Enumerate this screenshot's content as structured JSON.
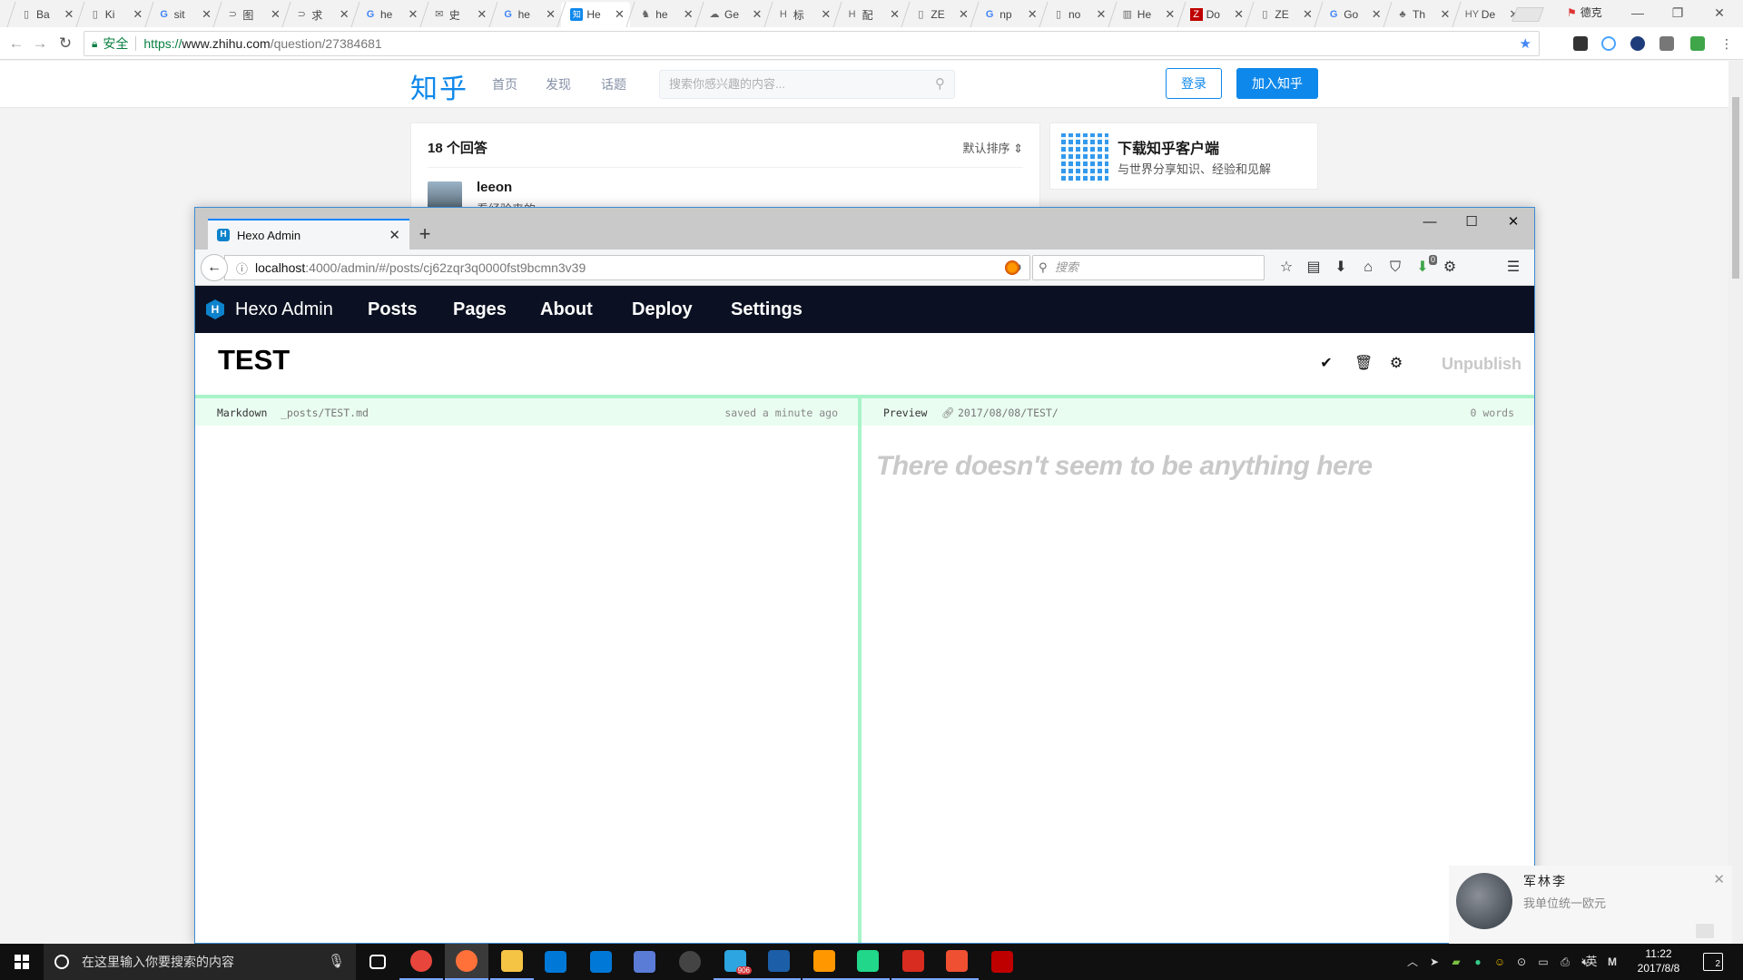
{
  "chrome": {
    "tabs": [
      {
        "icon": "page-icon",
        "title": "Ba"
      },
      {
        "icon": "page-icon",
        "title": "Ki"
      },
      {
        "icon": "google-icon",
        "title": "sit"
      },
      {
        "icon": "arrow-icon",
        "title": "图"
      },
      {
        "icon": "arrow-icon",
        "title": "求"
      },
      {
        "icon": "google-icon",
        "title": "he"
      },
      {
        "icon": "mail-icon",
        "title": "史"
      },
      {
        "icon": "google-icon",
        "title": "he"
      },
      {
        "icon": "zhihu-icon",
        "title": "He",
        "active": true
      },
      {
        "icon": "github-icon",
        "title": "he"
      },
      {
        "icon": "cloud-icon",
        "title": "Ge"
      },
      {
        "icon": "hexo-icon",
        "title": "标"
      },
      {
        "icon": "hexo-icon",
        "title": "配"
      },
      {
        "icon": "page-icon",
        "title": "ZE"
      },
      {
        "icon": "google-icon",
        "title": "np"
      },
      {
        "icon": "page-icon",
        "title": "no"
      },
      {
        "icon": "book-icon",
        "title": "He"
      },
      {
        "icon": "filezilla-icon",
        "title": "Do"
      },
      {
        "icon": "page-icon",
        "title": "ZE"
      },
      {
        "icon": "google-icon",
        "title": "Go"
      },
      {
        "icon": "baidu-icon",
        "title": "Th"
      },
      {
        "icon": "hy-icon",
        "title": "De"
      }
    ],
    "user_label": "德克",
    "window_controls": {
      "minimize": "—",
      "restore": "❐",
      "close": "✕"
    },
    "omnibox": {
      "secure_label": "安全",
      "protocol": "https://",
      "host": "www.zhihu.com",
      "path": "/question/27384681"
    }
  },
  "zhihu": {
    "logo": "知乎",
    "nav": [
      "首页",
      "发现",
      "话题"
    ],
    "search_placeholder": "搜索你感兴趣的内容...",
    "login_label": "登录",
    "join_label": "加入知乎",
    "answer_count": "18 个回答",
    "sort_label": "默认排序",
    "answer_user": "leeon",
    "answer_bio": "看经验来的",
    "app_title": "下载知乎客户端",
    "app_subtitle": "与世界分享知识、经验和见解"
  },
  "firefox": {
    "tab_title": "Hexo Admin",
    "url_host": "localhost",
    "url_path": ":4000/admin/#/posts/cj62zqr3q0000fst9bcmn3v39",
    "search_placeholder": "搜索",
    "download_badge": "0"
  },
  "hexo": {
    "brand": "Hexo Admin",
    "brand_logo": "H",
    "nav": [
      "Posts",
      "Pages",
      "About",
      "Deploy",
      "Settings"
    ],
    "post_title": "TEST",
    "unpublish_label": "Unpublish",
    "editor": {
      "label": "Markdown",
      "path": "_posts/TEST.md",
      "status": "saved a minute ago"
    },
    "preview": {
      "label": "Preview",
      "permalink": "2017/08/08/TEST/",
      "word_count": "0 words",
      "empty_text": "There doesn't seem to be anything here"
    }
  },
  "notification": {
    "name": "军林李",
    "message": "我单位统一欧元"
  },
  "taskbar": {
    "search_placeholder": "在这里输入你要搜索的内容",
    "apps": [
      {
        "name": "task-view",
        "color": "#101010"
      },
      {
        "name": "chrome",
        "color": "#e8453c"
      },
      {
        "name": "firefox",
        "color": "#ff7139"
      },
      {
        "name": "file-explorer",
        "color": "#f6c445"
      },
      {
        "name": "store",
        "color": "#0078d7"
      },
      {
        "name": "mail",
        "color": "#0078d7"
      },
      {
        "name": "remote-desktop",
        "color": "#5a7bd6"
      },
      {
        "name": "obs",
        "color": "#444444"
      },
      {
        "name": "telegram",
        "color": "#2ca5e0"
      },
      {
        "name": "virtualbox",
        "color": "#1d5ea8"
      },
      {
        "name": "sublime",
        "color": "#ff9800"
      },
      {
        "name": "jetbrains",
        "color": "#21d789"
      },
      {
        "name": "redis",
        "color": "#d82c20"
      },
      {
        "name": "git",
        "color": "#f05032"
      },
      {
        "name": "filezilla",
        "color": "#bf0000"
      }
    ],
    "telegram_badge": "906",
    "ime_label": "英",
    "time": "11:22",
    "date": "2017/8/8",
    "notification_count": "2"
  }
}
